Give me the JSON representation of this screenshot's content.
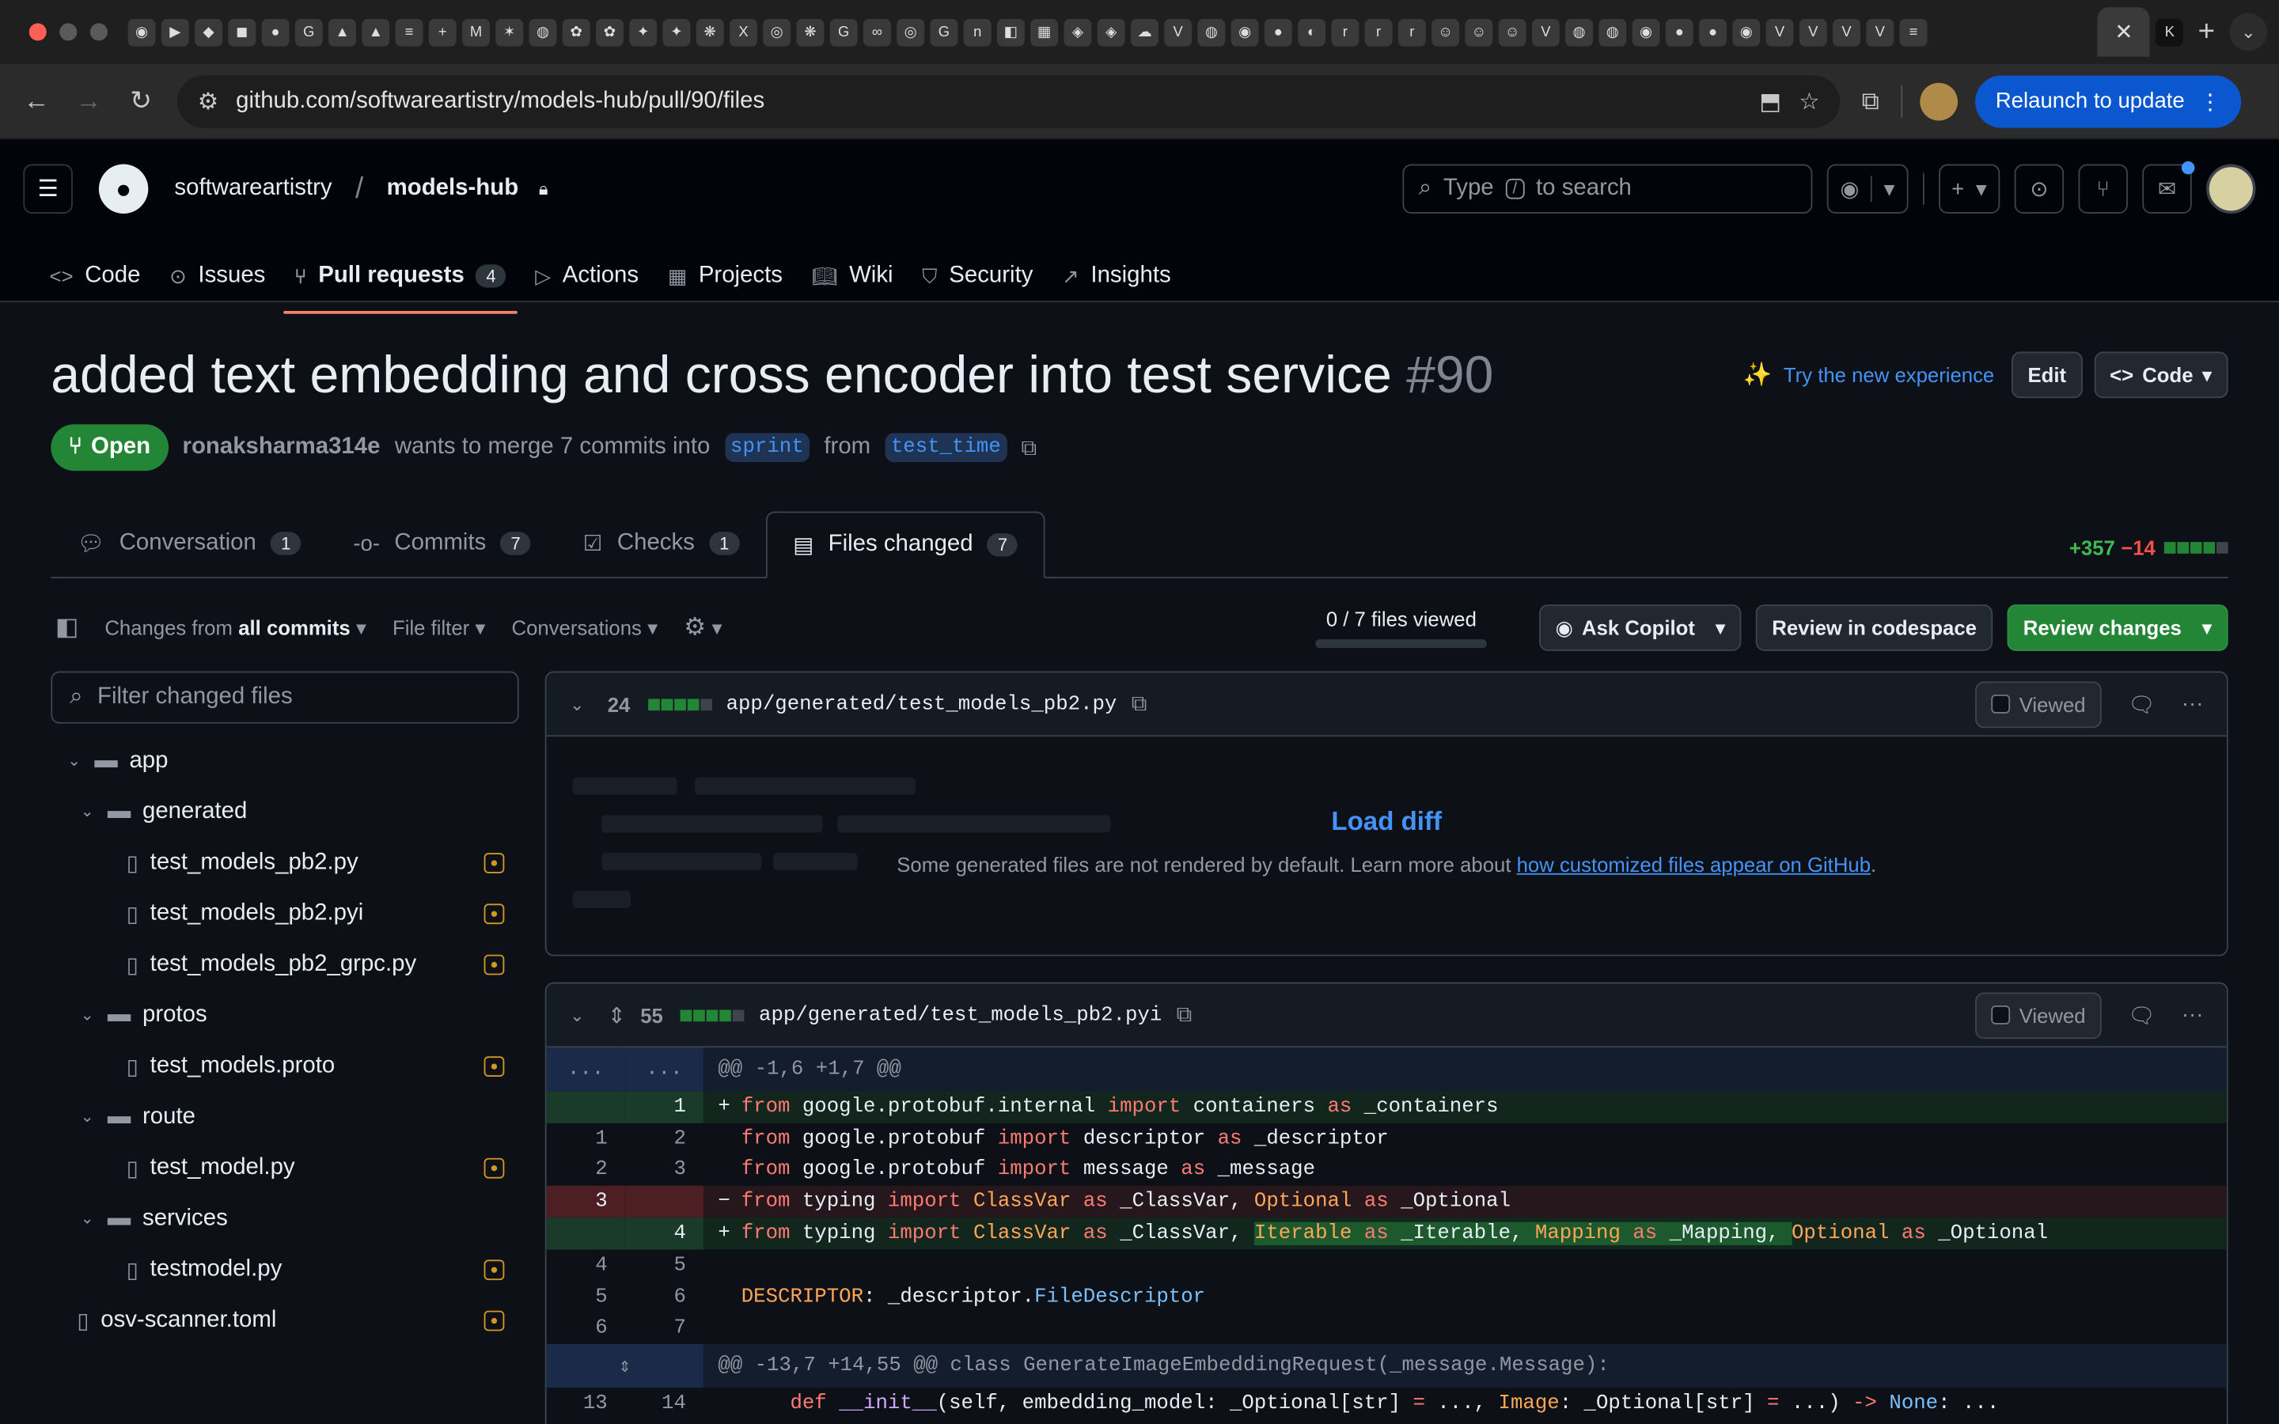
{
  "browser": {
    "url": "github.com/softwareartistry/models-hub/pull/90/files",
    "relaunch_label": "Relaunch to update",
    "active_tab_icon": "close-icon"
  },
  "gh": {
    "owner": "softwareartistry",
    "repo": "models-hub",
    "search_prefix": "Type",
    "search_key": "/",
    "search_suffix": "to search",
    "nav": [
      {
        "label": "Code",
        "icon": "code-icon"
      },
      {
        "label": "Issues",
        "icon": "issue-icon"
      },
      {
        "label": "Pull requests",
        "icon": "pull-request-icon",
        "count": "4"
      },
      {
        "label": "Actions",
        "icon": "play-icon"
      },
      {
        "label": "Projects",
        "icon": "table-icon"
      },
      {
        "label": "Wiki",
        "icon": "book-icon"
      },
      {
        "label": "Security",
        "icon": "shield-icon"
      },
      {
        "label": "Insights",
        "icon": "graph-icon"
      }
    ]
  },
  "pr": {
    "title": "added text embedding and cross encoder into test service",
    "number": "#90",
    "try_label": "Try the new experience",
    "edit_label": "Edit",
    "code_label": "Code",
    "state": "Open",
    "author": "ronaksharma314e",
    "meta_mid": "wants to merge 7 commits into",
    "base_branch": "sprint",
    "meta_from": "from",
    "head_branch": "test_time",
    "tabs": [
      {
        "label": "Conversation",
        "count": "1"
      },
      {
        "label": "Commits",
        "count": "7"
      },
      {
        "label": "Checks",
        "count": "1"
      },
      {
        "label": "Files changed",
        "count": "7"
      }
    ],
    "additions": "+357",
    "deletions": "−14"
  },
  "toolbar": {
    "changes_prefix": "Changes from",
    "changes_value": "all commits",
    "file_filter": "File filter",
    "conversations": "Conversations",
    "files_viewed": "0 / 7 files viewed",
    "ask_copilot": "Ask Copilot",
    "review_codespace": "Review in codespace",
    "review_changes": "Review changes"
  },
  "sidebar": {
    "filter_placeholder": "Filter changed files",
    "tree": [
      {
        "type": "folder",
        "name": "app",
        "depth": 0
      },
      {
        "type": "folder",
        "name": "generated",
        "depth": 1
      },
      {
        "type": "file",
        "name": "test_models_pb2.py",
        "depth": 2
      },
      {
        "type": "file",
        "name": "test_models_pb2.pyi",
        "depth": 2
      },
      {
        "type": "file",
        "name": "test_models_pb2_grpc.py",
        "depth": 2
      },
      {
        "type": "folder",
        "name": "protos",
        "depth": 1
      },
      {
        "type": "file",
        "name": "test_models.proto",
        "depth": 2
      },
      {
        "type": "folder",
        "name": "route",
        "depth": 1
      },
      {
        "type": "file",
        "name": "test_model.py",
        "depth": 2
      },
      {
        "type": "folder",
        "name": "services",
        "depth": 1
      },
      {
        "type": "file",
        "name": "testmodel.py",
        "depth": 2
      },
      {
        "type": "file",
        "name": "osv-scanner.toml",
        "depth": 0
      }
    ]
  },
  "files": [
    {
      "count": "24",
      "path": "app/generated/test_models_pb2.py",
      "viewed_label": "Viewed",
      "load_label": "Load diff",
      "load_msg": "Some generated files are not rendered by default. Learn more about",
      "load_link": "how customized files appear on GitHub"
    },
    {
      "count": "55",
      "path": "app/generated/test_models_pb2.pyi",
      "viewed_label": "Viewed",
      "hunk1": "@@ -1,6 +1,7 @@",
      "hunk2": "@@ -13,7 +14,55 @@ class GenerateImageEmbeddingRequest(_message.Message):"
    }
  ]
}
